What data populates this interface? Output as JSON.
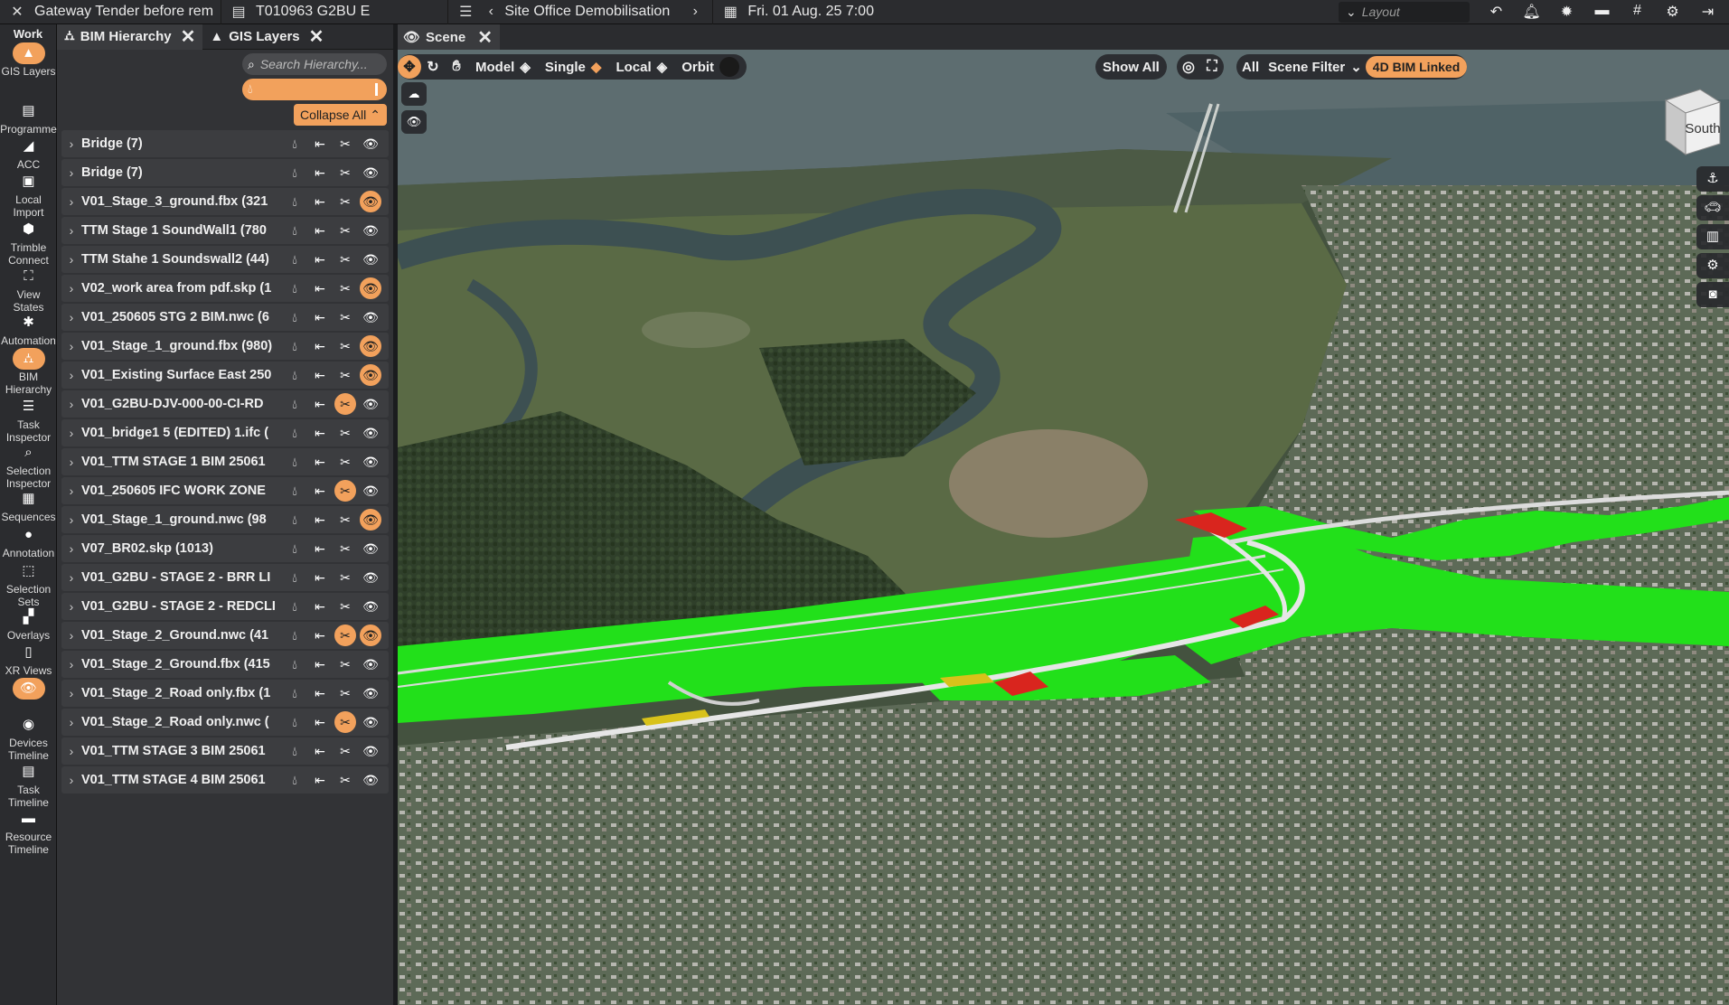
{
  "topbar": {
    "project": "Gateway Tender before rem",
    "file": "T010963 G2BU E",
    "schedule": "Site Office Demobilisation",
    "date": "Fri. 01 Aug. 25 7:00",
    "layout_placeholder": "Layout"
  },
  "sidebar": {
    "work_label": "Work",
    "items": [
      {
        "label": "GIS Layers",
        "icon": "gis-layers-icon",
        "active": true
      },
      {
        "label": "Programme",
        "icon": "document-icon"
      },
      {
        "label": "ACC",
        "icon": "acc-icon"
      },
      {
        "label": "Local Import",
        "icon": "import-icon"
      },
      {
        "label": "Trimble Connect",
        "icon": "trimble-icon"
      },
      {
        "label": "View States",
        "icon": "binoculars-icon"
      },
      {
        "label": "Automation",
        "icon": "automation-icon"
      },
      {
        "label": "BIM Hierarchy",
        "icon": "hierarchy-icon",
        "active": true
      },
      {
        "label": "Task Inspector",
        "icon": "task-inspector-icon"
      },
      {
        "label": "Selection Inspector",
        "icon": "search-icon"
      },
      {
        "label": "Sequences",
        "icon": "film-icon"
      },
      {
        "label": "Annotation",
        "icon": "comment-icon"
      },
      {
        "label": "Selection Sets",
        "icon": "selection-sets-icon"
      },
      {
        "label": "Overlays",
        "icon": "overlays-icon"
      },
      {
        "label": "XR Views",
        "icon": "phone-icon"
      },
      {
        "label": "",
        "icon": "eye-icon",
        "active": true
      },
      {
        "label": "Devices Timeline",
        "icon": "device-icon"
      },
      {
        "label": "Task Timeline",
        "icon": "document-icon"
      },
      {
        "label": "Resource Timeline",
        "icon": "truck-icon"
      }
    ]
  },
  "panel": {
    "tabs": [
      {
        "label": "BIM Hierarchy",
        "active": true
      },
      {
        "label": "GIS Layers",
        "active": false
      }
    ],
    "search_placeholder": "Search Hierarchy...",
    "collapse_label": "Collapse All",
    "layers": [
      {
        "name": "Bridge (7)",
        "clip_on": false,
        "eye_on": false
      },
      {
        "name": "Bridge (7)",
        "clip_on": false,
        "eye_on": false
      },
      {
        "name": "V01_Stage_3_ground.fbx (321",
        "clip_on": false,
        "eye_on": true
      },
      {
        "name": "TTM Stage 1 SoundWall1 (780",
        "clip_on": false,
        "eye_on": false
      },
      {
        "name": "TTM Stahe 1 Soundswall2 (44)",
        "clip_on": false,
        "eye_on": false
      },
      {
        "name": "V02_work area from pdf.skp (1",
        "clip_on": false,
        "eye_on": true
      },
      {
        "name": "V01_250605 STG 2 BIM.nwc (6",
        "clip_on": false,
        "eye_on": false
      },
      {
        "name": "V01_Stage_1_ground.fbx (980)",
        "clip_on": false,
        "eye_on": true
      },
      {
        "name": "V01_Existing Surface East 250",
        "clip_on": false,
        "eye_on": true
      },
      {
        "name": "V01_G2BU-DJV-000-00-CI-RD",
        "clip_on": true,
        "eye_on": false
      },
      {
        "name": "V01_bridge1 5 (EDITED) 1.ifc (",
        "clip_on": false,
        "eye_on": false
      },
      {
        "name": "V01_TTM STAGE 1 BIM 25061",
        "clip_on": false,
        "eye_on": false
      },
      {
        "name": "V01_250605 IFC WORK ZONE",
        "clip_on": true,
        "eye_on": false
      },
      {
        "name": "V01_Stage_1_ground.nwc (98",
        "clip_on": false,
        "eye_on": true
      },
      {
        "name": "V07_BR02.skp (1013)",
        "clip_on": false,
        "eye_on": false
      },
      {
        "name": "V01_G2BU - STAGE 2 - BRR LI",
        "clip_on": false,
        "eye_on": false
      },
      {
        "name": "V01_G2BU - STAGE 2 - REDCLI",
        "clip_on": false,
        "eye_on": false
      },
      {
        "name": "V01_Stage_2_Ground.nwc (41",
        "clip_on": true,
        "eye_on": true
      },
      {
        "name": "V01_Stage_2_Ground.fbx (415",
        "clip_on": false,
        "eye_on": false
      },
      {
        "name": "V01_Stage_2_Road only.fbx (1",
        "clip_on": false,
        "eye_on": false
      },
      {
        "name": "V01_Stage_2_Road only.nwc (",
        "clip_on": true,
        "eye_on": false
      },
      {
        "name": "V01_TTM STAGE 3 BIM 25061",
        "clip_on": false,
        "eye_on": false
      },
      {
        "name": "V01_TTM STAGE 4 BIM 25061",
        "clip_on": false,
        "eye_on": false
      }
    ]
  },
  "scene": {
    "tab_label": "Scene",
    "model_label": "Model",
    "single_label": "Single",
    "local_label": "Local",
    "orbit_label": "Orbit",
    "show_all_label": "Show All",
    "all_label": "All",
    "scene_filter_label": "Scene Filter",
    "bim_linked_label": "4D BIM Linked",
    "cube_label": "South"
  },
  "colors": {
    "accent": "#f2a15c",
    "bim_green": "#22e01a",
    "bim_red": "#d9251e",
    "bim_yellow": "#d8c21a"
  }
}
